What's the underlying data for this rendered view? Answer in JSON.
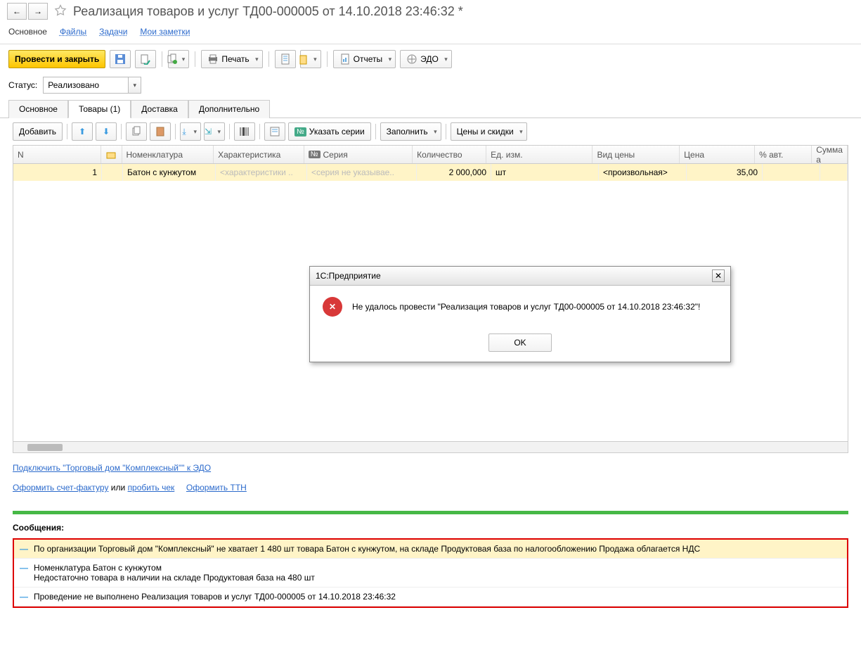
{
  "header": {
    "title": "Реализация товаров и услуг ТД00-000005 от 14.10.2018 23:46:32 *"
  },
  "linkTabs": {
    "main": "Основное",
    "files": "Файлы",
    "tasks": "Задачи",
    "notes": "Мои заметки"
  },
  "toolbar": {
    "postClose": "Провести и закрыть",
    "print": "Печать",
    "reports": "Отчеты",
    "edo": "ЭДО"
  },
  "status": {
    "label": "Статус:",
    "value": "Реализовано"
  },
  "docTabs": {
    "main": "Основное",
    "goods": "Товары (1)",
    "delivery": "Доставка",
    "extra": "Дополнительно"
  },
  "gridToolbar": {
    "add": "Добавить",
    "series": "Указать серии",
    "fill": "Заполнить",
    "prices": "Цены и скидки"
  },
  "gridHeaders": {
    "n": "N",
    "nomenclature": "Номенклатура",
    "characteristic": "Характеристика",
    "series": "Серия",
    "qty": "Количество",
    "unit": "Ед. изм.",
    "priceType": "Вид цены",
    "price": "Цена",
    "pctAuto": "% авт.",
    "sum": "Сумма а"
  },
  "gridRow": {
    "n": "1",
    "nomenclature": "Батон с кунжутом",
    "characteristic": "<характеристики ..",
    "series": "<серия не указывае..",
    "qty": "2 000,000",
    "unit": "шт",
    "priceType": "<произвольная>",
    "price": "35,00"
  },
  "dialog": {
    "title": "1С:Предприятие",
    "message": "Не удалось провести \"Реализация товаров и услуг ТД00-000005 от 14.10.2018 23:46:32\"!",
    "ok": "OK"
  },
  "bottomLinks": {
    "connectEdo": "Подключить \"Торговый дом \"Комплексный\"\" к ЭДО",
    "invoice": "Оформить счет-фактуру",
    "or": "или",
    "receipt": "пробить чек",
    "ttn": "Оформить ТТН"
  },
  "messages": {
    "title": "Сообщения:",
    "items": [
      "По организации Торговый дом \"Комплексный\" не хватает 1 480 шт товара Батон с кунжутом, на складе Продуктовая база  по налогообложению Продажа облагается НДС",
      "Номенклатура Батон с кунжутом\nНедостаточно товара в наличии на складе Продуктовая база на 480 шт",
      "Проведение не выполнено Реализация товаров и услуг ТД00-000005 от 14.10.2018 23:46:32"
    ]
  }
}
